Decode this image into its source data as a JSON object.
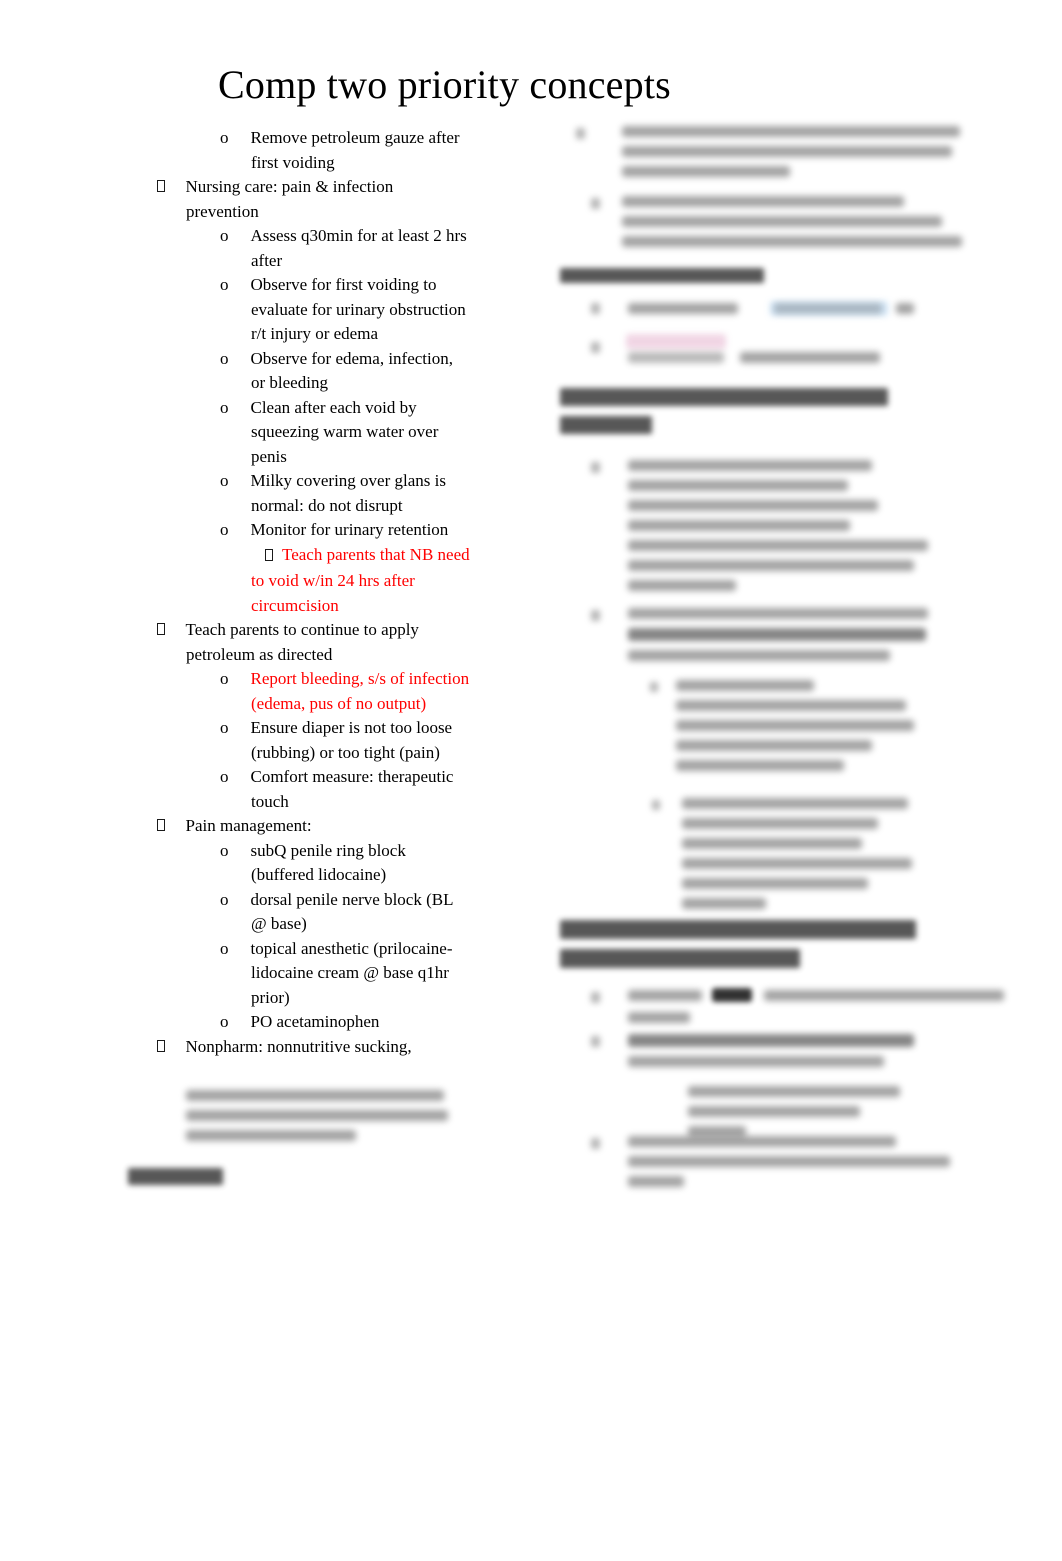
{
  "document": {
    "title": "Comp two priority concepts",
    "background_color": "#ffffff",
    "body_text_color": "#000000",
    "emphasis_color": "#FF0000",
    "highlight_colors": {
      "blue": "#cfe4f6",
      "pink": "#f0d3e3"
    }
  },
  "left_column": {
    "items": [
      {
        "level": 2,
        "marker": "o",
        "text": "Remove petroleum gauze after first voiding",
        "color": "black"
      },
      {
        "level": 1,
        "marker": "box",
        "text": "Nursing care: pain & infection prevention",
        "color": "black"
      },
      {
        "level": 2,
        "marker": "o",
        "text": "Assess q30min for at least 2 hrs after",
        "color": "black"
      },
      {
        "level": 2,
        "marker": "o",
        "text": "Observe for first voiding to evaluate for urinary obstruction r/t injury or edema",
        "color": "black"
      },
      {
        "level": 2,
        "marker": "o",
        "text": "Observe for edema, infection, or bleeding",
        "color": "black"
      },
      {
        "level": 2,
        "marker": "o",
        "text": "Clean after each void by squeezing warm water over penis",
        "color": "black"
      },
      {
        "level": 2,
        "marker": "o",
        "text": "Milky covering over glans is normal: do not disrupt",
        "color": "black"
      },
      {
        "level": 2,
        "marker": "o",
        "text_before": "Monitor for urinary retention",
        "inline_marker": "box",
        "text_red": "Teach parents that NB need to void w/in 24 hrs after circumcision",
        "color": "mixed"
      },
      {
        "level": 1,
        "marker": "box",
        "text": "Teach parents to continue to apply petroleum as directed",
        "color": "black"
      },
      {
        "level": 2,
        "marker": "o",
        "text": "Report bleeding, s/s of infection (edema, pus of no output)",
        "color": "red"
      },
      {
        "level": 2,
        "marker": "o",
        "text": "Ensure diaper is not too loose (rubbing) or too tight (pain)",
        "color": "black"
      },
      {
        "level": 2,
        "marker": "o",
        "text": "Comfort measure: therapeutic touch",
        "color": "black"
      },
      {
        "level": 1,
        "marker": "box",
        "text": "Pain management:",
        "color": "black"
      },
      {
        "level": 2,
        "marker": "o",
        "text": "subQ penile ring block (buffered lidocaine)",
        "color": "black"
      },
      {
        "level": 2,
        "marker": "o",
        "text": "dorsal penile nerve block (BL @ base)",
        "color": "black"
      },
      {
        "level": 2,
        "marker": "o",
        "text": "topical anesthetic (prilocaine-lidocaine cream @ base q1hr prior)",
        "color": "black"
      },
      {
        "level": 2,
        "marker": "o",
        "text": "PO acetaminophen",
        "color": "black"
      },
      {
        "level": 1,
        "marker": "box",
        "text": "Nonpharm: nonnutritive sucking,",
        "color": "black"
      }
    ],
    "obscured_note": "Text following \"Nonpharm: nonnutritive sucking,\" is blurred and unreadable.",
    "obscured_heading_note": "A bold heading near the bottom of the left column is blurred and unreadable."
  },
  "right_column": {
    "obscured_note": "All right-column content is blurred and unreadable; only layout, bullet positions and highlight colors are discernible.",
    "visible_highlights": [
      {
        "color": "#cfe4f6",
        "note": "blue highlight on a short run of text"
      },
      {
        "color": "#f0d3e3",
        "note": "pink highlight on a short run of text"
      }
    ]
  }
}
